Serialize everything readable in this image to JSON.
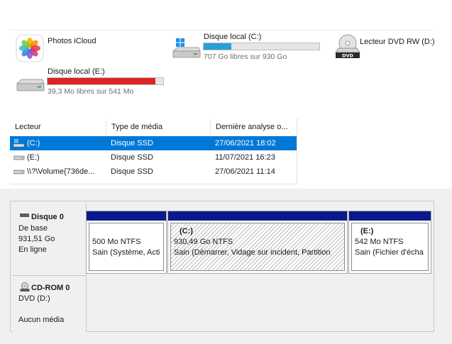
{
  "drives": [
    {
      "name": "Photos iCloud",
      "icon": "photos-icloud-icon"
    },
    {
      "name": "Disque local (C:)",
      "free_text": "707 Go libres sur 930 Go",
      "used_fraction": 0.24,
      "bar_color": "#26a0da",
      "icon": "windows-drive-icon"
    },
    {
      "name": "Lecteur DVD RW (D:)",
      "icon": "dvd-drive-icon",
      "icon_text": "DVD"
    },
    {
      "name": "Disque local (E:)",
      "free_text": "39,3 Mo libres sur 541 Mo",
      "used_fraction": 0.93,
      "bar_color": "#da2626",
      "icon": "hard-drive-icon"
    }
  ],
  "table": {
    "headers": [
      "Lecteur",
      "Type de média",
      "Dernière analyse o..."
    ],
    "rows": [
      {
        "drive": "(C:)",
        "media": "Disque SSD",
        "last": "27/06/2021 18:02",
        "selected": true
      },
      {
        "drive": "(E:)",
        "media": "Disque SSD",
        "last": "11/07/2021 16:23",
        "selected": false
      },
      {
        "drive": "\\\\?\\Volume{736de...",
        "media": "Disque SSD",
        "last": "27/06/2021 11:14",
        "selected": false
      }
    ]
  },
  "disk0": {
    "title": "Disque 0",
    "type": "De base",
    "size": "931,51 Go",
    "status": "En ligne",
    "partitions": [
      {
        "label": "",
        "size": "500 Mo NTFS",
        "status": "Sain (Système, Acti"
      },
      {
        "label": "(C:)",
        "size": "930,49 Go NTFS",
        "status": "Sain (Démarrer, Vidage sur incident, Partition"
      },
      {
        "label": "(E:)",
        "size": "542 Mo NTFS",
        "status": "Sain (Fichier d'écha"
      }
    ]
  },
  "cdrom": {
    "title": "CD-ROM 0",
    "type": "DVD (D:)",
    "status": "Aucun média"
  },
  "colors": {
    "selection": "#0078d7",
    "partition_header": "#0a1a8c"
  }
}
